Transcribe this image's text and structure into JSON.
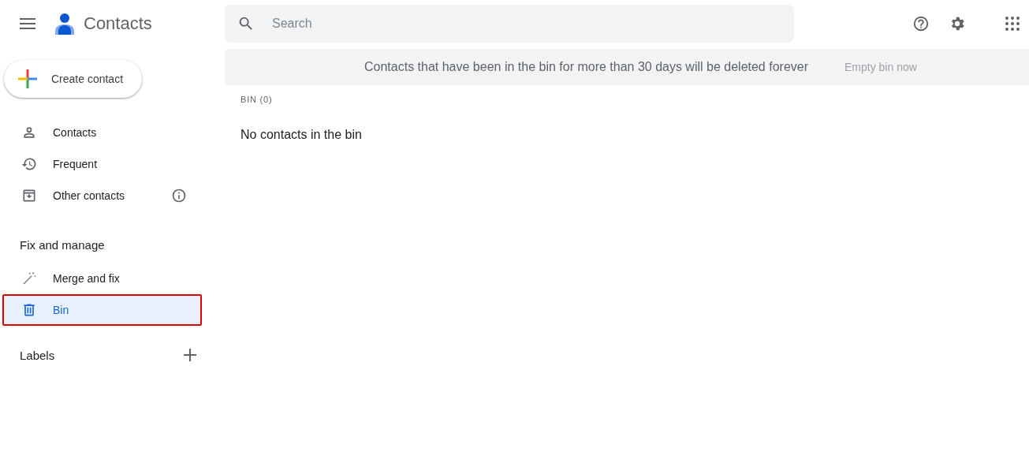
{
  "app": {
    "title": "Contacts"
  },
  "search": {
    "placeholder": "Search"
  },
  "create_button": "Create contact",
  "nav": [
    {
      "label": "Contacts",
      "selected": false,
      "info": false
    },
    {
      "label": "Frequent",
      "selected": false,
      "info": false
    },
    {
      "label": "Other contacts",
      "selected": false,
      "info": true
    }
  ],
  "fix_section": {
    "title": "Fix and manage",
    "items": [
      {
        "label": "Merge and fix",
        "selected": false,
        "annotated": false
      },
      {
        "label": "Bin",
        "selected": true,
        "annotated": true
      }
    ]
  },
  "labels_section": {
    "title": "Labels"
  },
  "banner": {
    "message": "Contacts that have been in the bin for more than 30 days will be deleted forever",
    "action": "Empty bin now",
    "action_disabled": true
  },
  "list": {
    "heading": "BIN (0)",
    "empty_text": "No contacts in the bin"
  }
}
